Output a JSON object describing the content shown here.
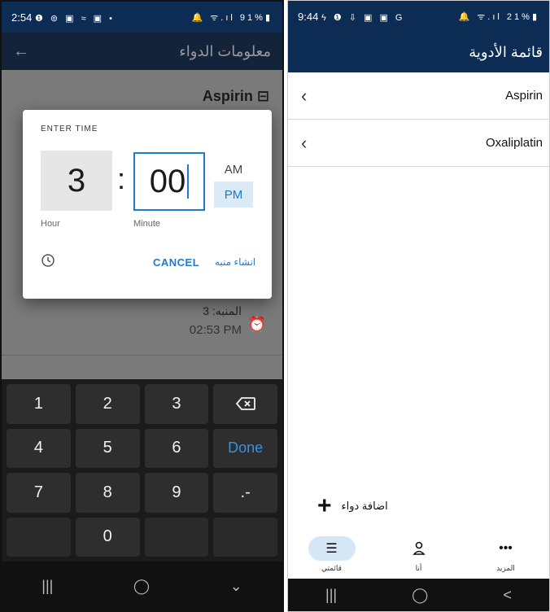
{
  "left": {
    "status": {
      "time": "2:54",
      "left_icons": "❶ ⊚ ▣ ≈ ▣ •",
      "right": "🔔 ᯤ.ıl 91%▮"
    },
    "appbar": {
      "title": "معلومات الدواء"
    },
    "content": {
      "med_name": "Aspirin",
      "dose_label": "المنبه: 3",
      "dose_time": "02:53 PM"
    },
    "dialog": {
      "header": "ENTER TIME",
      "hour": "3",
      "colon": ":",
      "minute": "00",
      "am": "AM",
      "pm": "PM",
      "hour_label": "Hour",
      "minute_label": "Minute",
      "cancel": "CANCEL",
      "create": "انشاء منبه"
    },
    "keypad": [
      "1",
      "2",
      "3",
      "⌫",
      "4",
      "5",
      "6",
      "Done",
      "7",
      "8",
      "9",
      ".-",
      "",
      "0",
      "",
      ""
    ],
    "nav": [
      "|||",
      "◯",
      "⌄"
    ]
  },
  "right": {
    "status": {
      "time": "9:44",
      "left_icons": "ϟ ❶ ⇩ ▣ ▣ G",
      "right": "🔔 ᯤ.ıl 21%▮"
    },
    "appbar": {
      "title": "قائمة الأدوية"
    },
    "items": [
      {
        "name": "Aspirin"
      },
      {
        "name": "Oxaliplatin"
      }
    ],
    "add": {
      "label": "اضافة دواء"
    },
    "bottom_nav": [
      {
        "label": "قائمتي"
      },
      {
        "label": "أنا"
      },
      {
        "label": "المزيد"
      }
    ],
    "nav": [
      "|||",
      "◯",
      "<"
    ]
  },
  "colors": {
    "appbar": "#0d2c54",
    "accent": "#1e7bc8",
    "pm_bg": "#dbeaf7"
  }
}
